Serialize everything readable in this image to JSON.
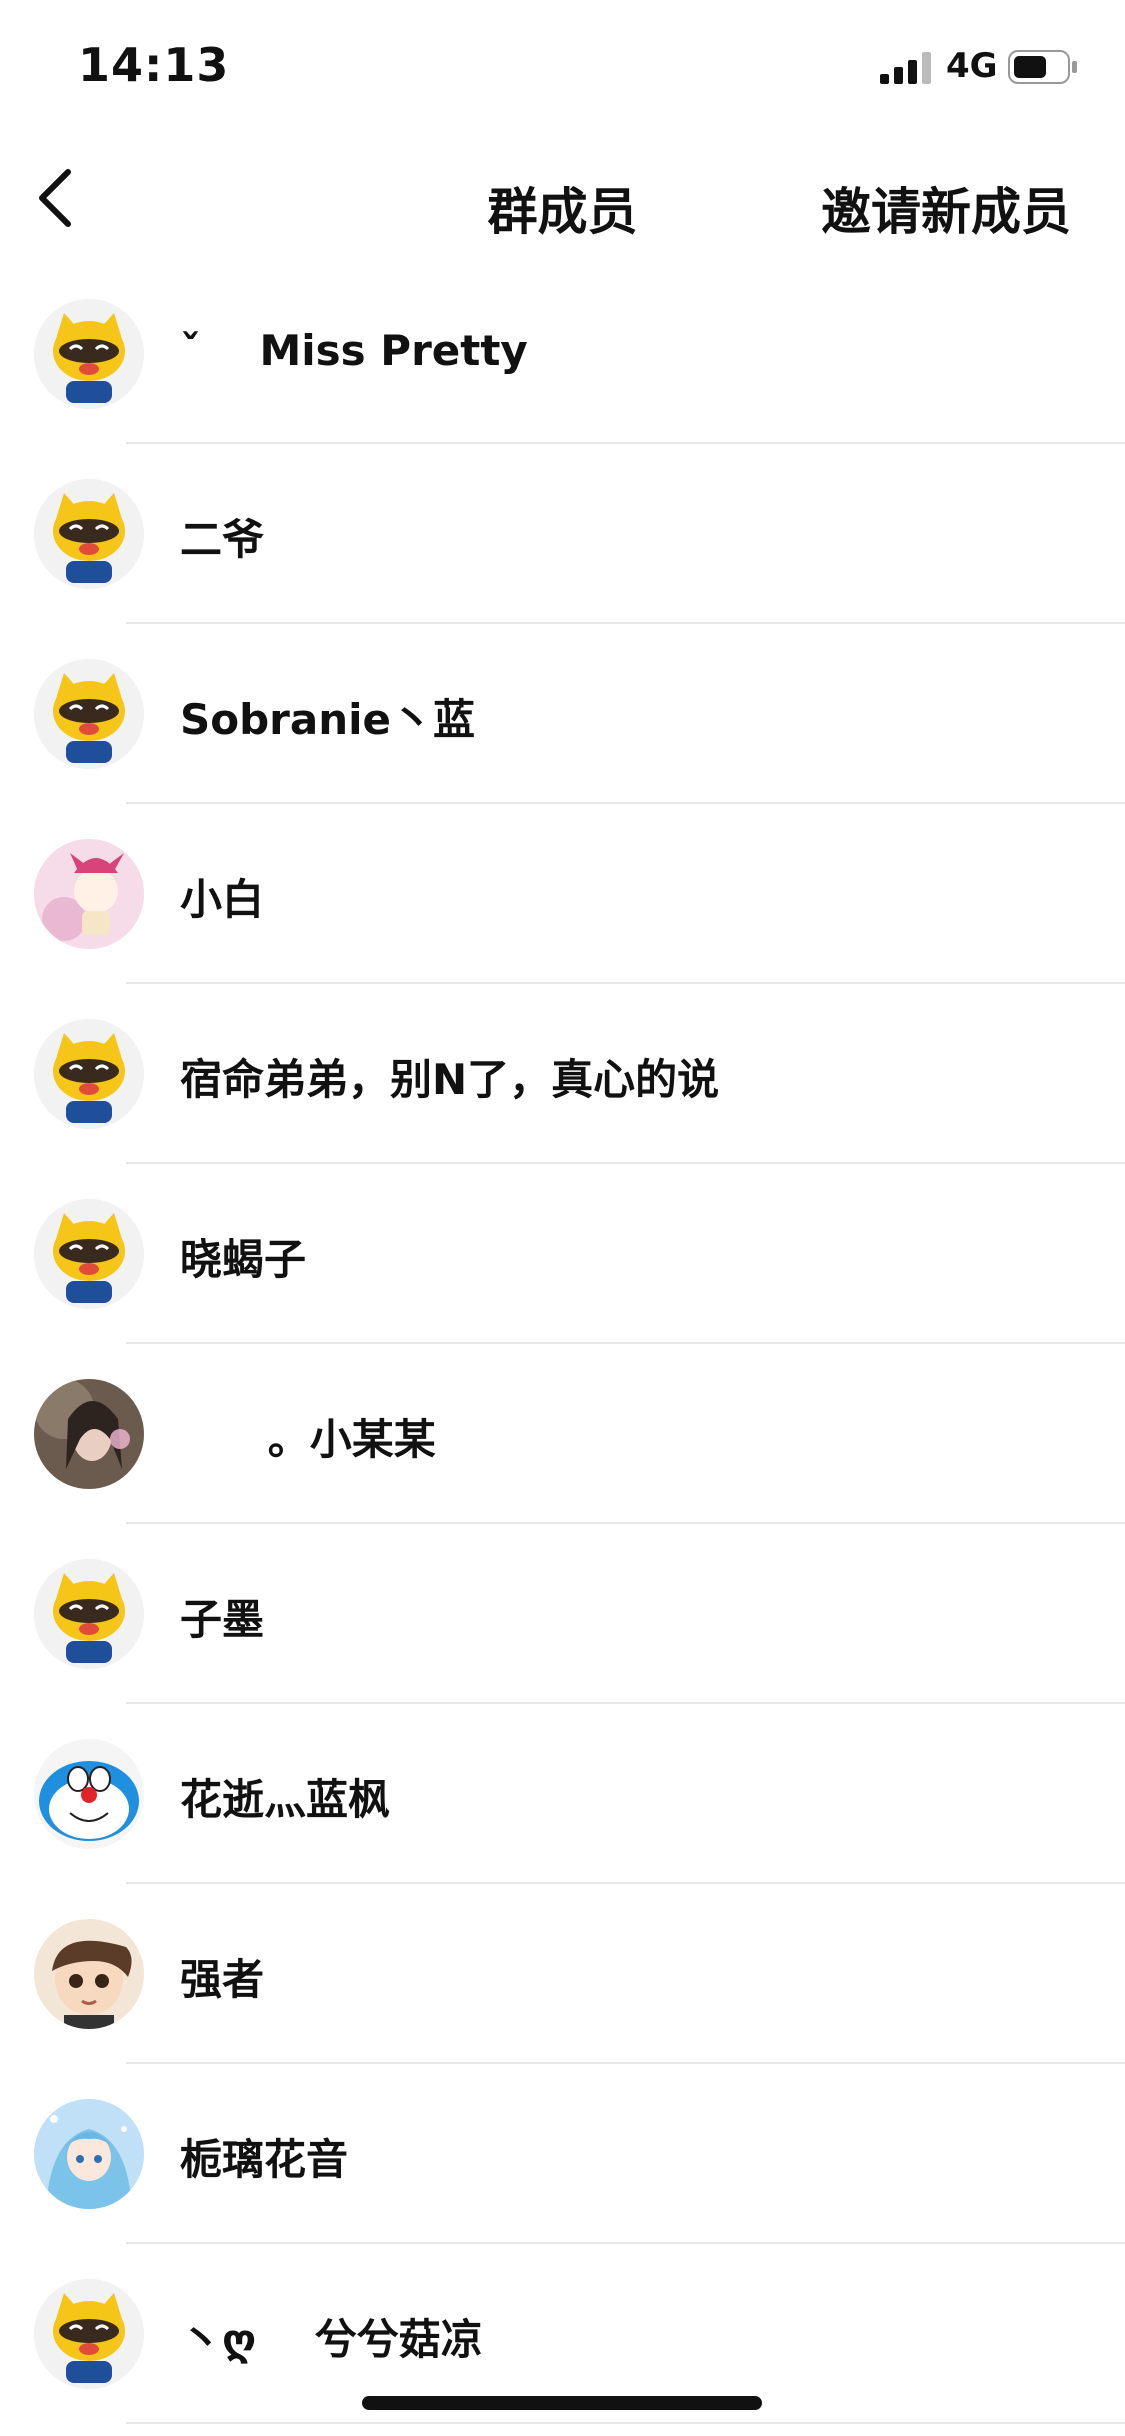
{
  "status_bar": {
    "time": "14:13",
    "network": "4G"
  },
  "nav": {
    "title": "群成员",
    "invite_label": "邀请新成员"
  },
  "members": [
    {
      "name": "ˇ    Miss Pretty",
      "avatar": "raccoon-avatar"
    },
    {
      "name": "二爷",
      "avatar": "raccoon-avatar"
    },
    {
      "name": "Sobranie丶蓝",
      "avatar": "raccoon-avatar"
    },
    {
      "name": "小白",
      "avatar": "pink-cartoon-avatar"
    },
    {
      "name": "宿命弟弟，别N了，真心的说",
      "avatar": "raccoon-avatar"
    },
    {
      "name": "晓蝎子",
      "avatar": "raccoon-avatar"
    },
    {
      "name": "      。小某某",
      "avatar": "photo-avatar"
    },
    {
      "name": "子墨",
      "avatar": "raccoon-avatar"
    },
    {
      "name": "花逝灬蓝枫",
      "avatar": "doraemon-avatar"
    },
    {
      "name": "强者",
      "avatar": "cartoon-boy-avatar"
    },
    {
      "name": "栀璃花音",
      "avatar": "anime-girl-avatar"
    },
    {
      "name": "丶ღ    兮兮菇凉",
      "avatar": "raccoon-avatar"
    }
  ],
  "colors": {
    "text": "#111111",
    "divider": "#e8e8e8",
    "background": "#ffffff"
  }
}
